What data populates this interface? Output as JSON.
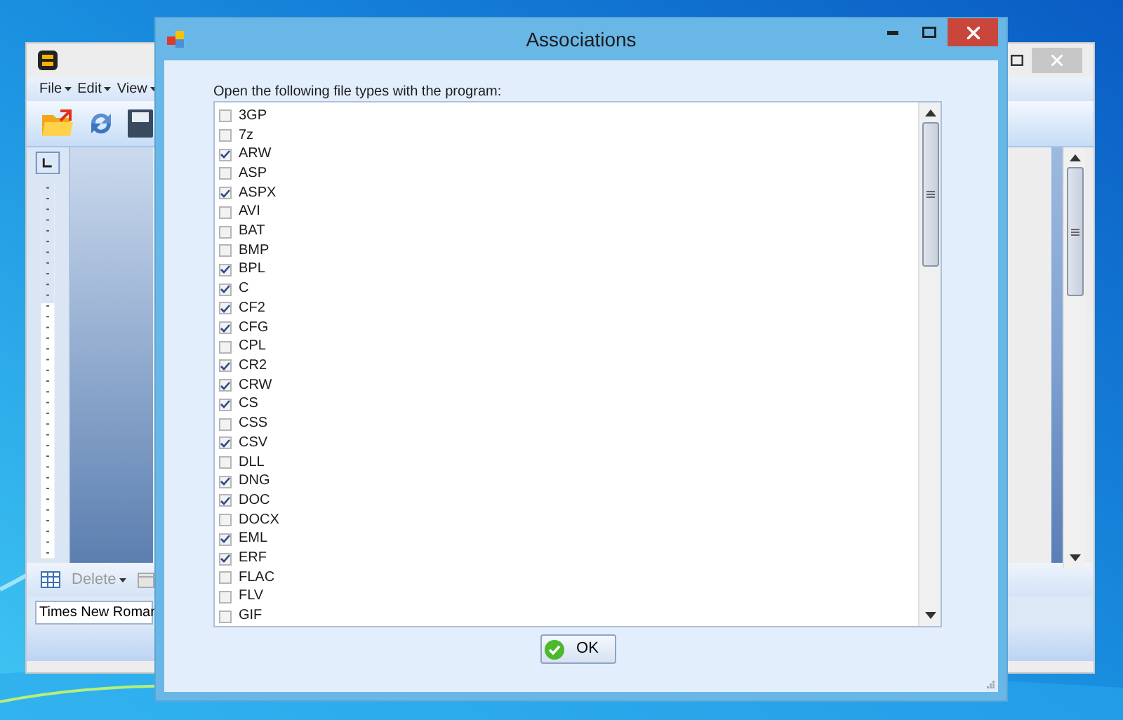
{
  "background_window": {
    "menu": [
      "File",
      "Edit",
      "View"
    ],
    "toolbar_button": "Delete",
    "font_field": "Times New Roman"
  },
  "dialog": {
    "title": "Associations",
    "prompt": "Open the following file types with the program:",
    "file_types": [
      {
        "label": "3GP",
        "checked": false
      },
      {
        "label": "7z",
        "checked": false
      },
      {
        "label": "ARW",
        "checked": true
      },
      {
        "label": "ASP",
        "checked": false
      },
      {
        "label": "ASPX",
        "checked": true
      },
      {
        "label": "AVI",
        "checked": false
      },
      {
        "label": "BAT",
        "checked": false
      },
      {
        "label": "BMP",
        "checked": false
      },
      {
        "label": "BPL",
        "checked": true
      },
      {
        "label": "C",
        "checked": true
      },
      {
        "label": "CF2",
        "checked": true
      },
      {
        "label": "CFG",
        "checked": true
      },
      {
        "label": "CPL",
        "checked": false
      },
      {
        "label": "CR2",
        "checked": true
      },
      {
        "label": "CRW",
        "checked": true
      },
      {
        "label": "CS",
        "checked": true
      },
      {
        "label": "CSS",
        "checked": false
      },
      {
        "label": "CSV",
        "checked": true
      },
      {
        "label": "DLL",
        "checked": false
      },
      {
        "label": "DNG",
        "checked": true
      },
      {
        "label": "DOC",
        "checked": true
      },
      {
        "label": "DOCX",
        "checked": false
      },
      {
        "label": "EML",
        "checked": true
      },
      {
        "label": "ERF",
        "checked": true
      },
      {
        "label": "FLAC",
        "checked": false
      },
      {
        "label": "FLV",
        "checked": false
      },
      {
        "label": "GIF",
        "checked": false
      }
    ],
    "ok_button": "OK"
  }
}
